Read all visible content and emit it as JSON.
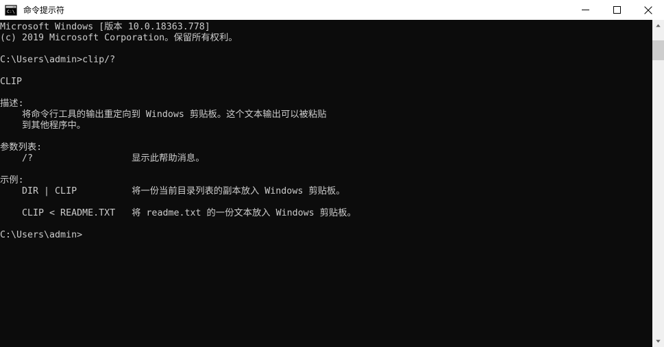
{
  "window": {
    "title": "命令提示符",
    "icon": "console-icon",
    "controls": {
      "minimize_label": "最小化",
      "maximize_label": "最大化",
      "close_label": "关闭"
    }
  },
  "console": {
    "background_color": "#0c0c0c",
    "text_color": "#cccccc",
    "lines": [
      "Microsoft Windows [版本 10.0.18363.778]",
      "(c) 2019 Microsoft Corporation。保留所有权利。",
      "",
      "C:\\Users\\admin>clip/?",
      "",
      "CLIP",
      "",
      "描述:",
      "    将命令行工具的输出重定向到 Windows 剪贴板。这个文本输出可以被粘贴",
      "    到其他程序中。",
      "",
      "参数列表:",
      "    /?                  显示此帮助消息。",
      "",
      "示例:",
      "    DIR | CLIP          将一份当前目录列表的副本放入 Windows 剪贴板。",
      "",
      "    CLIP < README.TXT   将 readme.txt 的一份文本放入 Windows 剪贴板。",
      "",
      "C:\\Users\\admin>"
    ],
    "text": "Microsoft Windows [版本 10.0.18363.778]\n(c) 2019 Microsoft Corporation。保留所有权利。\n\nC:\\Users\\admin>clip/?\n\nCLIP\n\n描述:\n    将命令行工具的输出重定向到 Windows 剪贴板。这个文本输出可以被粘贴\n    到其他程序中。\n\n参数列表:\n    /?                  显示此帮助消息。\n\n示例:\n    DIR | CLIP          将一份当前目录列表的副本放入 Windows 剪贴板。\n\n    CLIP < README.TXT   将 readme.txt 的一份文本放入 Windows 剪贴板。\n\nC:\\Users\\admin>",
    "command_entered": "clip/?",
    "prompt": "C:\\Users\\admin>"
  },
  "scrollbar": {
    "up_arrow": "scroll-up-icon",
    "down_arrow": "scroll-down-icon",
    "thumb_color": "#cdcdcd",
    "track_color": "#f0f0f0"
  }
}
